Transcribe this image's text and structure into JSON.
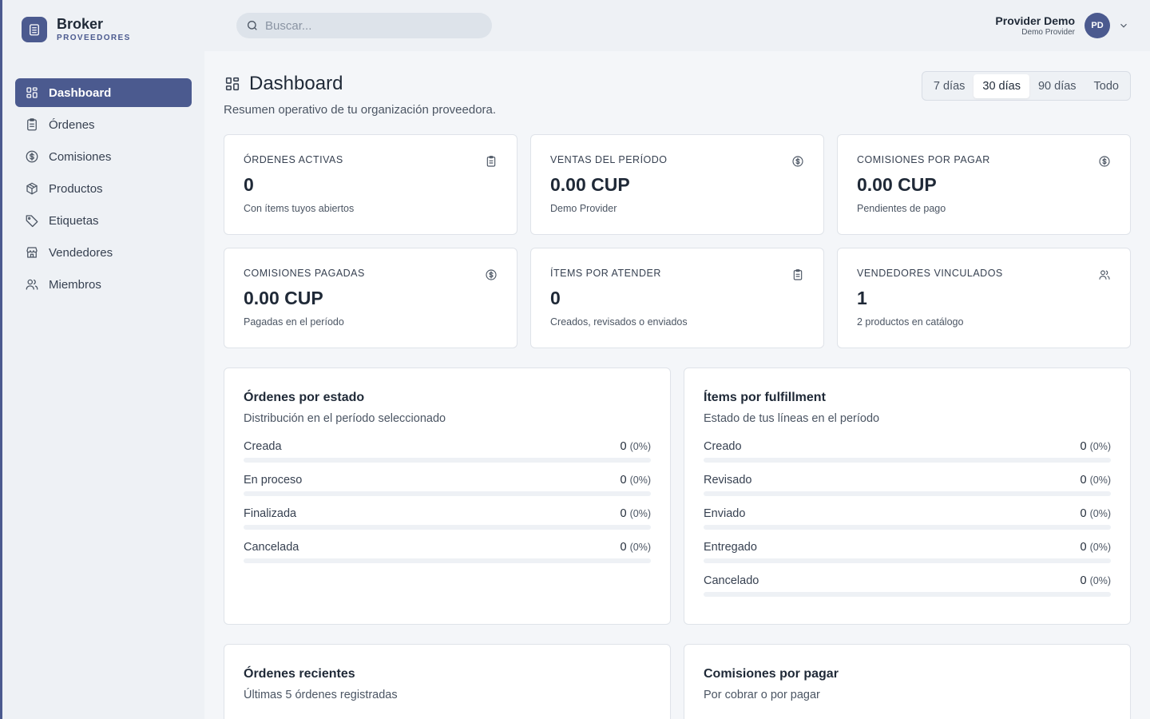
{
  "brand": {
    "name": "Broker",
    "subtitle": "PROVEEDORES",
    "logo_icon": "building-icon"
  },
  "sidebar": {
    "items": [
      {
        "label": "Dashboard",
        "icon": "grid-icon",
        "active": true
      },
      {
        "label": "Órdenes",
        "icon": "clipboard-icon"
      },
      {
        "label": "Comisiones",
        "icon": "dollar-circle-icon"
      },
      {
        "label": "Productos",
        "icon": "box-icon"
      },
      {
        "label": "Etiquetas",
        "icon": "tag-icon"
      },
      {
        "label": "Vendedores",
        "icon": "store-icon"
      },
      {
        "label": "Miembros",
        "icon": "users-icon"
      }
    ]
  },
  "search": {
    "placeholder": "Buscar..."
  },
  "user": {
    "name": "Provider Demo",
    "org": "Demo Provider",
    "initials": "PD"
  },
  "page": {
    "title": "Dashboard",
    "subtitle": "Resumen operativo de tu organización proveedora."
  },
  "range": {
    "options": [
      "7 días",
      "30 días",
      "90 días",
      "Todo"
    ],
    "selected": "30 días"
  },
  "stats": [
    {
      "label": "ÓRDENES ACTIVAS",
      "value": "0",
      "caption": "Con ítems tuyos abiertos",
      "icon": "clipboard-icon"
    },
    {
      "label": "VENTAS DEL PERÍODO",
      "value": "0.00 CUP",
      "caption": "Demo Provider",
      "icon": "dollar-circle-icon"
    },
    {
      "label": "COMISIONES POR PAGAR",
      "value": "0.00 CUP",
      "caption": "Pendientes de pago",
      "icon": "dollar-circle-icon"
    },
    {
      "label": "COMISIONES PAGADAS",
      "value": "0.00 CUP",
      "caption": "Pagadas en el período",
      "icon": "dollar-circle-icon"
    },
    {
      "label": "ÍTEMS POR ATENDER",
      "value": "0",
      "caption": "Creados, revisados o enviados",
      "icon": "clipboard-icon"
    },
    {
      "label": "VENDEDORES VINCULADOS",
      "value": "1",
      "caption": "2 productos en catálogo",
      "icon": "users-icon"
    }
  ],
  "orders_by_status": {
    "title": "Órdenes por estado",
    "subtitle": "Distribución en el período seleccionado",
    "rows": [
      {
        "label": "Creada",
        "count": "0",
        "pct": "(0%)",
        "fraction": 0
      },
      {
        "label": "En proceso",
        "count": "0",
        "pct": "(0%)",
        "fraction": 0
      },
      {
        "label": "Finalizada",
        "count": "0",
        "pct": "(0%)",
        "fraction": 0
      },
      {
        "label": "Cancelada",
        "count": "0",
        "pct": "(0%)",
        "fraction": 0
      }
    ]
  },
  "items_by_fulfillment": {
    "title": "Ítems por fulfillment",
    "subtitle": "Estado de tus líneas en el período",
    "rows": [
      {
        "label": "Creado",
        "count": "0",
        "pct": "(0%)",
        "fraction": 0
      },
      {
        "label": "Revisado",
        "count": "0",
        "pct": "(0%)",
        "fraction": 0
      },
      {
        "label": "Enviado",
        "count": "0",
        "pct": "(0%)",
        "fraction": 0
      },
      {
        "label": "Entregado",
        "count": "0",
        "pct": "(0%)",
        "fraction": 0
      },
      {
        "label": "Cancelado",
        "count": "0",
        "pct": "(0%)",
        "fraction": 0
      }
    ]
  },
  "recent_orders": {
    "title": "Órdenes recientes",
    "subtitle": "Últimas 5 órdenes registradas"
  },
  "pending_commissions": {
    "title": "Comisiones por pagar",
    "subtitle": "Por cobrar o por pagar"
  },
  "colors": {
    "accent": "#4b5a8f",
    "background": "#f4f6f9",
    "sidebar": "#eef1f5"
  }
}
